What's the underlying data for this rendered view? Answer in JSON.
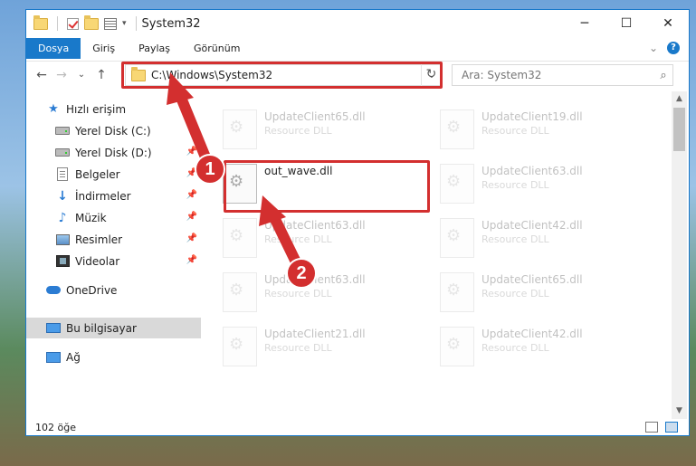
{
  "window": {
    "title": "System32"
  },
  "title_controls": {
    "minimize": "─",
    "maximize": "☐",
    "close": "✕"
  },
  "ribbon": {
    "tabs": [
      "Dosya",
      "Giriş",
      "Paylaş",
      "Görünüm"
    ],
    "expand": "⌄",
    "help": "?"
  },
  "nav": {
    "back": "←",
    "forward": "→",
    "recent": "⌄",
    "up": "↑"
  },
  "address": {
    "path": "C:\\Windows\\System32",
    "dropdown": "⌄",
    "refresh": "↻"
  },
  "search": {
    "placeholder": "Ara: System32",
    "icon": "⌕"
  },
  "sidebar": {
    "items": [
      {
        "label": "Hızlı erişim",
        "icon": "star-icon"
      },
      {
        "label": "Yerel Disk (C:)",
        "icon": "drive-icon"
      },
      {
        "label": "Yerel Disk (D:)",
        "icon": "drive-icon"
      },
      {
        "label": "Belgeler",
        "icon": "document-icon"
      },
      {
        "label": "İndirmeler",
        "icon": "download-icon"
      },
      {
        "label": "Müzik",
        "icon": "music-icon"
      },
      {
        "label": "Resimler",
        "icon": "pictures-icon"
      },
      {
        "label": "Videolar",
        "icon": "video-icon"
      },
      {
        "label": "OneDrive",
        "icon": "cloud-icon"
      },
      {
        "label": "Bu bilgisayar",
        "icon": "computer-icon"
      },
      {
        "label": "Ağ",
        "icon": "network-icon"
      }
    ],
    "pin_glyph": "📌"
  },
  "files": [
    {
      "name": "UpdateClient65.dll",
      "type": "Resource DLL"
    },
    {
      "name": "UpdateClient19.dll",
      "type": "Resource DLL"
    },
    {
      "name": "out_wave.dll",
      "type": ""
    },
    {
      "name": "UpdateClient63.dll",
      "type": "Resource DLL"
    },
    {
      "name": "UpdateClient63.dll",
      "type": "Resource DLL"
    },
    {
      "name": "UpdateClient42.dll",
      "type": "Resource DLL"
    },
    {
      "name": "UpdateClient63.dll",
      "type": "Resource DLL"
    },
    {
      "name": "UpdateClient65.dll",
      "type": "Resource DLL"
    },
    {
      "name": "UpdateClient21.dll",
      "type": "Resource DLL"
    },
    {
      "name": "UpdateClient42.dll",
      "type": "Resource DLL"
    }
  ],
  "status": {
    "count": "102 öğe"
  },
  "annotations": {
    "marker1": "1",
    "marker2": "2",
    "color": "#d32f2f"
  }
}
